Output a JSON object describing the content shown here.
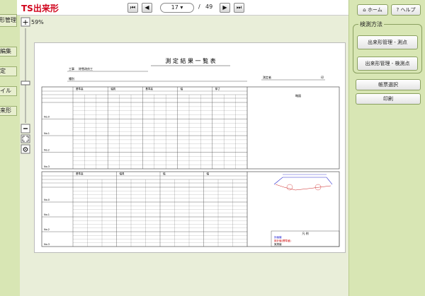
{
  "app_title": "TS出来形",
  "left_tabs": [
    "形管理",
    "編集",
    "定",
    "イル",
    "来形"
  ],
  "toolbar": {
    "first_icon": "⏮",
    "prev_icon": "◀",
    "page_current": "17",
    "page_sep": "/",
    "page_total": "49",
    "next_icon": "▶",
    "last_icon": "⏭"
  },
  "right": {
    "home_label": "ホーム",
    "help_label": "ヘルプ",
    "method_title": "検測方法",
    "method_btn1": "出来形管理 - 測点",
    "method_btn2": "出来形管理 - 検測点",
    "select_label": "帳票選択",
    "print_label": "印刷"
  },
  "zoom": {
    "percent": "59%",
    "plus": "+",
    "minus": "−"
  },
  "doc": {
    "title": "測 定 結 果 一 覧 表",
    "project_label": "工事",
    "project_name": "除雪改良工",
    "section_label": "種別",
    "measurer_label": "測定者",
    "measurer_value": "印",
    "remark_label": "略図",
    "legend_title": "凡 例",
    "legend": [
      {
        "text": "計画値",
        "color": "#0000cc"
      },
      {
        "text": "設計値(標準値)",
        "color": "#cc0000"
      },
      {
        "text": "実測値",
        "color": "#000000"
      }
    ],
    "row_labels_top": [
      "No.0",
      "No.1",
      "No.2",
      "No.3"
    ],
    "row_labels_bottom": [
      "No.0",
      "No.1",
      "No.2",
      "No.3"
    ],
    "header_titles_top": [
      "基準高",
      "幅員",
      "基準高",
      "幅",
      "厚さ"
    ],
    "header_titles_bottom": [
      "基準高",
      "幅員",
      "幅",
      "幅"
    ]
  },
  "colors": {
    "accent_red": "#d0021b",
    "panel_green": "#d8e6b4"
  }
}
